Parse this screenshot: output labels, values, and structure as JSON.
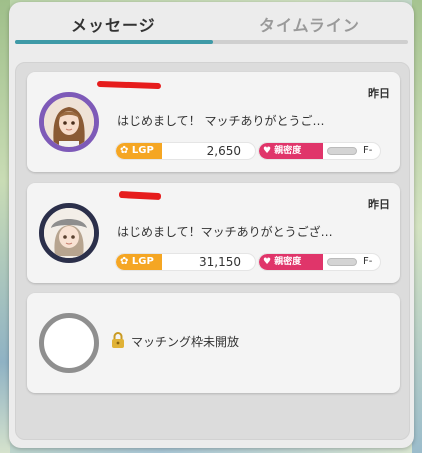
{
  "tabs": [
    {
      "label": "メッセージ",
      "active": true
    },
    {
      "label": "タイムライン",
      "active": false
    }
  ],
  "accent_color": "#3f9aa7",
  "conversations": [
    {
      "name_redacted": true,
      "date": "昨日",
      "preview": "はじめまして！ マッチありがとうご…",
      "lgp_label": "LGP",
      "lgp_value": "2,650",
      "intimacy_label": "親密度",
      "intimacy_level": 0,
      "intimacy_rank": "F-",
      "avatar_ring_color": "#7e5ab8",
      "avatar_icon": "long-brown-hair-girl-portrait"
    },
    {
      "name_redacted": true,
      "date": "昨日",
      "preview": "はじめまして！マッチありがとうござ…",
      "lgp_label": "LGP",
      "lgp_value": "31,150",
      "intimacy_label": "親密度",
      "intimacy_level": 0,
      "intimacy_rank": "F-",
      "avatar_ring_color": "#2b2f4a",
      "avatar_icon": "grey-beret-girl-portrait"
    }
  ],
  "locked_slot": {
    "text": "マッチング枠未開放",
    "icon": "lock-icon"
  }
}
